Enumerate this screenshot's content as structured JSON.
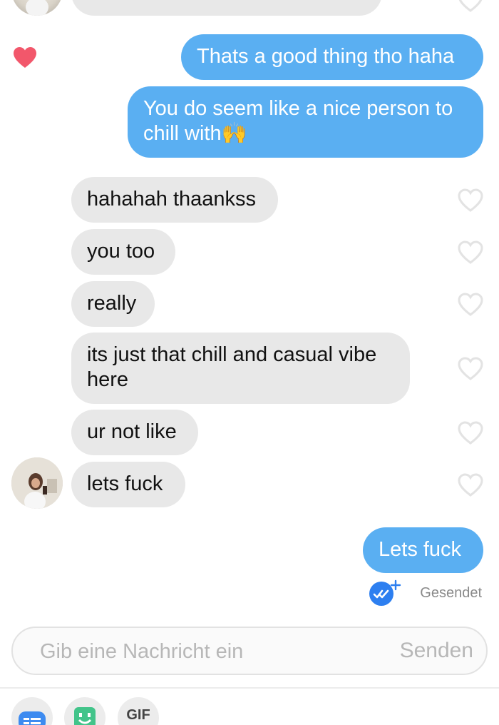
{
  "colors": {
    "sent_bubble": "#5aaff2",
    "received_bubble": "#e8e8e8",
    "liked_heart": "#f2576b",
    "empty_heart": "#e3e3e3",
    "read_badge": "#2d7ff0"
  },
  "messages": [
    {
      "side": "sent",
      "text": "Thats a good thing tho haha",
      "liked": true
    },
    {
      "side": "sent",
      "text": "You do seem like a nice person to chill with🙌"
    },
    {
      "side": "received",
      "text": "hahahah thaankss",
      "liked": false
    },
    {
      "side": "received",
      "text": "you too",
      "liked": false
    },
    {
      "side": "received",
      "text": "really",
      "liked": false
    },
    {
      "side": "received",
      "text": "its just that chill and casual vibe here",
      "liked": false
    },
    {
      "side": "received",
      "text": "ur not like",
      "liked": false
    },
    {
      "side": "received",
      "text": "lets fuck",
      "liked": false
    },
    {
      "side": "sent",
      "text": "Lets fuck"
    }
  ],
  "status": {
    "icon": "double-check-icon",
    "label": "Gesendet"
  },
  "composer": {
    "placeholder": "Gib eine Nachricht ein",
    "send_label": "Senden"
  },
  "toolbar": {
    "gif_label": "GIF",
    "icons": [
      "sticker-icon",
      "bitmoji-icon",
      "gif-icon"
    ]
  }
}
